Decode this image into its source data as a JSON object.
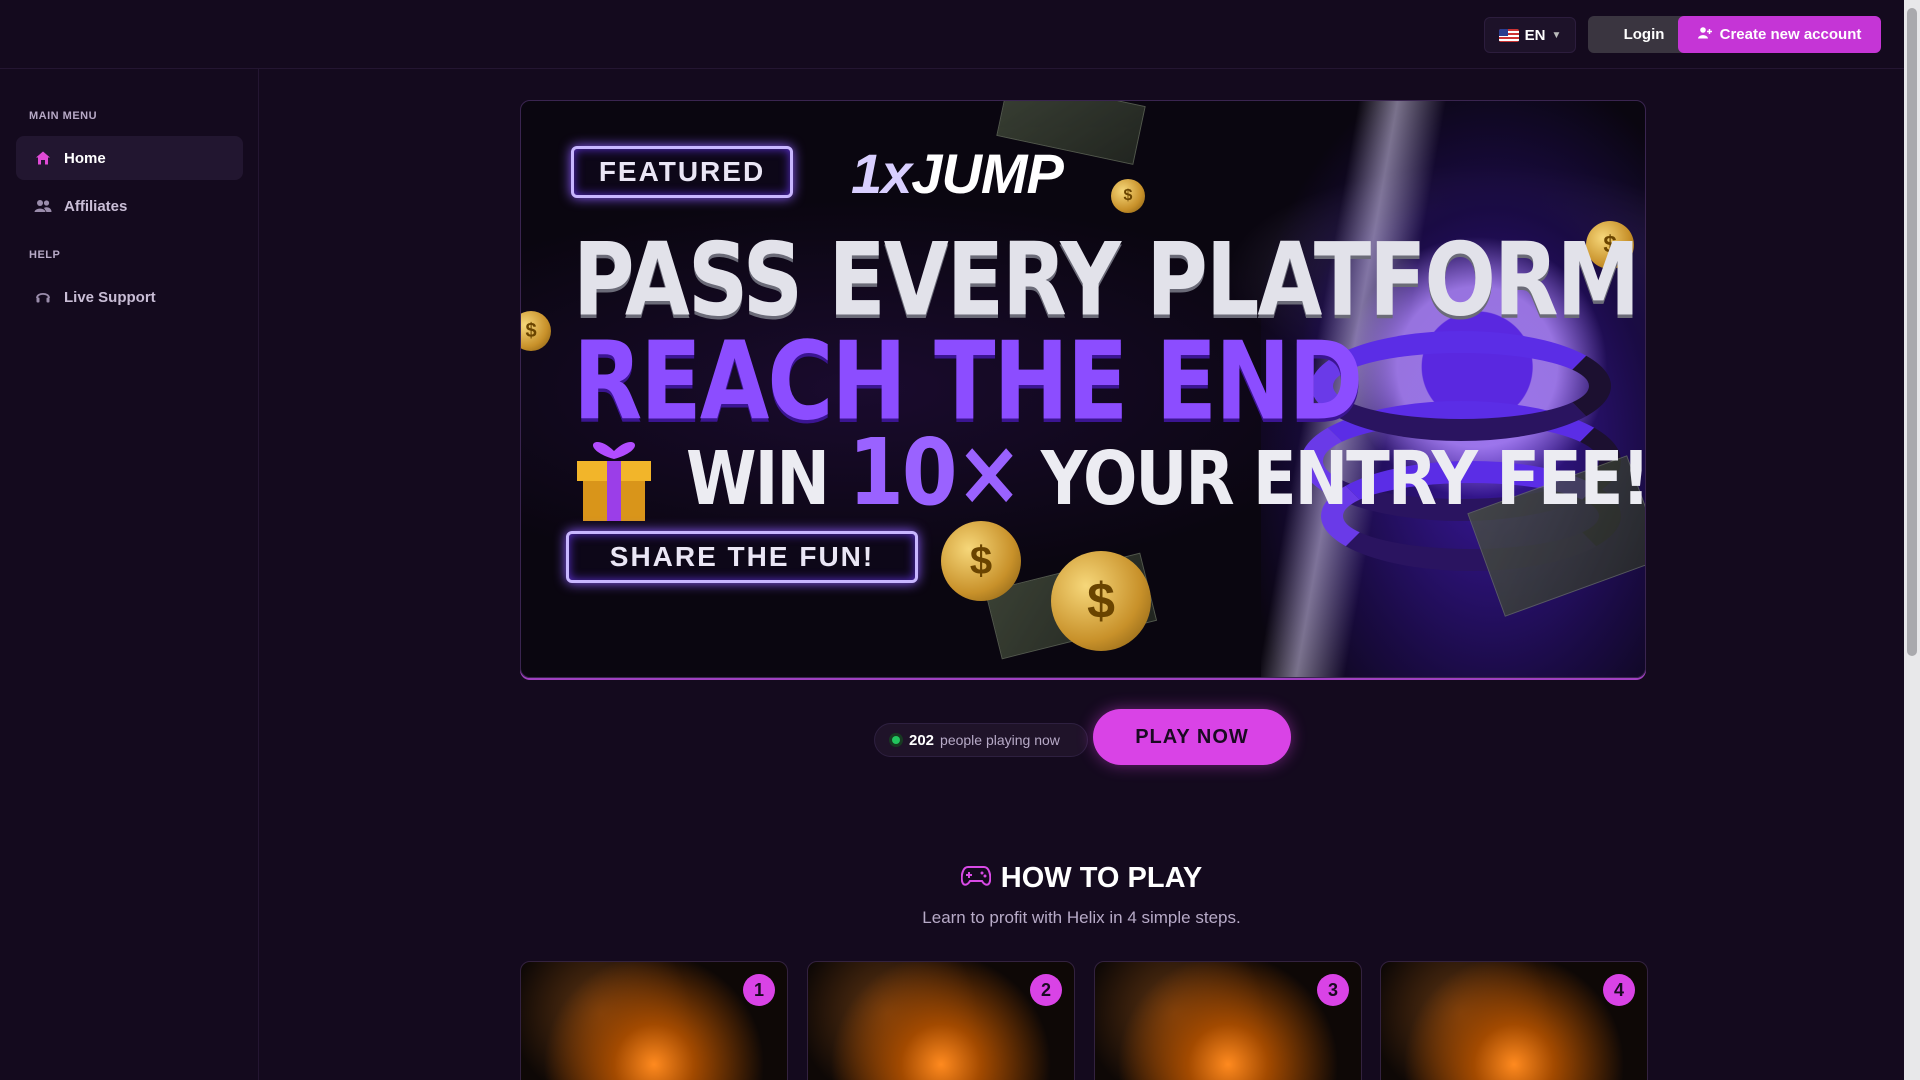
{
  "header": {
    "language": "EN",
    "login_label": "Login",
    "create_account_label": "Create new account"
  },
  "sidebar": {
    "sections": [
      {
        "title": "MAIN MENU",
        "items": [
          {
            "label": "Home",
            "icon": "home-icon",
            "active": true
          },
          {
            "label": "Affiliates",
            "icon": "users-icon",
            "active": false
          }
        ]
      },
      {
        "title": "HELP",
        "items": [
          {
            "label": "Live Support",
            "icon": "headset-icon",
            "active": false
          }
        ]
      }
    ]
  },
  "banner": {
    "featured": "FEATURED",
    "logo_prefix": "1x",
    "logo_text": "JUMP",
    "headline1": "PASS EVERY PLATFORM",
    "headline2": "REACH THE END",
    "headline3_win": "WIN",
    "headline3_mult": "10×",
    "headline3_rest": "YOUR ENTRY FEE!",
    "share": "SHARE THE FUN!"
  },
  "players": {
    "count": "202",
    "label": "people playing now"
  },
  "play_button_label": "PLAY NOW",
  "how_to_play": {
    "title": "HOW TO PLAY",
    "subtitle": "Learn to profit with Helix in 4 simple steps.",
    "steps": [
      "1",
      "2",
      "3",
      "4"
    ]
  },
  "colors": {
    "background": "#140a1e",
    "accent": "#d943e6",
    "banner_purple": "#8c4dff",
    "online": "#22c55e"
  }
}
